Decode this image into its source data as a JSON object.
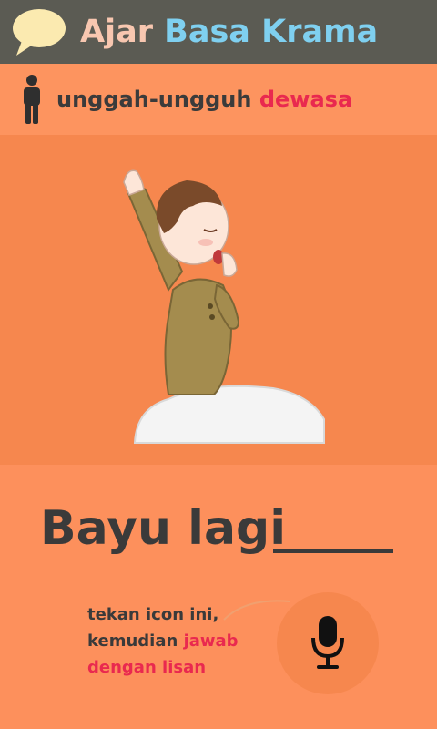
{
  "header": {
    "title_part1": "Ajar",
    "title_part2": "Basa Krama",
    "logo_icon": "speech-bubble-icon"
  },
  "level": {
    "icon": "person-icon",
    "label": "unggah-ungguh",
    "level_name": "dewasa"
  },
  "illustration": {
    "description_icon": "boy-yawning-illustration"
  },
  "question": {
    "text": "Bayu lagi"
  },
  "hint": {
    "line1": "tekan icon ini,",
    "line2_prefix": "kemudian",
    "line2_accent": "jawab",
    "line3": "dengan lisan"
  },
  "mic": {
    "icon": "microphone-icon"
  },
  "colors": {
    "header_bg": "#5b5b53",
    "level_bar_bg": "#fd945f",
    "illustration_bg": "#f6874e",
    "accent_red": "#e9294f",
    "title_pink": "#f8c7b0",
    "title_blue": "#7fd0f0"
  }
}
